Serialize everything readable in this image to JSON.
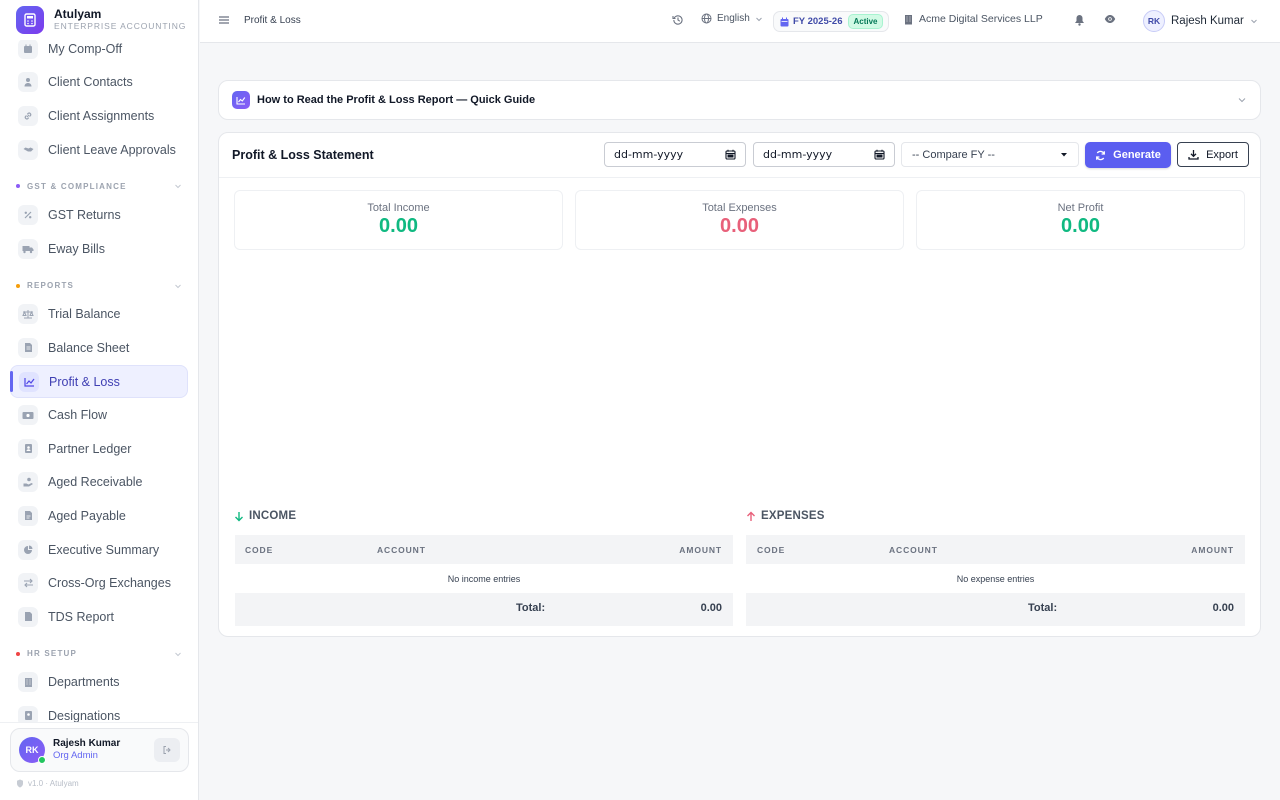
{
  "brand": {
    "name": "Atulyam",
    "tagline": "ENTERPRISE ACCOUNTING"
  },
  "sidebar": {
    "items_top": [
      {
        "label": "My Comp-Off",
        "icon": "calendar-icon"
      },
      {
        "label": "Client Contacts",
        "icon": "person-icon"
      },
      {
        "label": "Client Assignments",
        "icon": "link-icon"
      },
      {
        "label": "Client Leave Approvals",
        "icon": "handshake-icon"
      }
    ],
    "sections": [
      {
        "title": "GST & COMPLIANCE",
        "color": "#8b5cf6",
        "items": [
          {
            "label": "GST Returns",
            "icon": "percent-icon"
          },
          {
            "label": "Eway Bills",
            "icon": "truck-icon"
          }
        ]
      },
      {
        "title": "REPORTS",
        "color": "#f59e0b",
        "items": [
          {
            "label": "Trial Balance",
            "icon": "scale-icon"
          },
          {
            "label": "Balance Sheet",
            "icon": "document-icon"
          },
          {
            "label": "Profit & Loss",
            "icon": "chart-line-icon",
            "active": true
          },
          {
            "label": "Cash Flow",
            "icon": "money-icon"
          },
          {
            "label": "Partner Ledger",
            "icon": "ledger-icon"
          },
          {
            "label": "Aged Receivable",
            "icon": "hand-coin-icon"
          },
          {
            "label": "Aged Payable",
            "icon": "invoice-icon"
          },
          {
            "label": "Executive Summary",
            "icon": "pie-chart-icon"
          },
          {
            "label": "Cross-Org Exchanges",
            "icon": "exchange-icon"
          },
          {
            "label": "TDS Report",
            "icon": "file-icon"
          }
        ]
      },
      {
        "title": "HR SETUP",
        "color": "#ef4444",
        "items": [
          {
            "label": "Departments",
            "icon": "building-icon"
          },
          {
            "label": "Designations",
            "icon": "id-badge-icon"
          }
        ]
      }
    ],
    "user": {
      "initials": "RK",
      "name": "Rajesh Kumar",
      "role": "Org Admin"
    },
    "footer": "v1.0 · Atulyam"
  },
  "topbar": {
    "breadcrumb": "Profit & Loss",
    "language": "English",
    "fy": "FY 2025-26",
    "fy_status": "Active",
    "org": "Acme Digital Services LLP",
    "user_initials": "RK",
    "user_name": "Rajesh Kumar"
  },
  "guide": {
    "title": "How to Read the Profit & Loss Report — Quick Guide"
  },
  "report": {
    "title": "Profit & Loss Statement",
    "from_date": "dd-mm-yyyy",
    "to_date": "dd-mm-yyyy",
    "compare": "-- Compare FY --",
    "generate_label": "Generate",
    "export_label": "Export",
    "kpis": [
      {
        "label": "Total Income",
        "value": "0.00",
        "color": "#10b981"
      },
      {
        "label": "Total Expenses",
        "value": "0.00",
        "color": "#e8607a"
      },
      {
        "label": "Net Profit",
        "value": "0.00",
        "color": "#10b981"
      }
    ],
    "income": {
      "title": "INCOME",
      "columns": [
        "CODE",
        "ACCOUNT",
        "AMOUNT"
      ],
      "empty": "No income entries",
      "total_label": "Total:",
      "total_value": "0.00"
    },
    "expenses": {
      "title": "EXPENSES",
      "columns": [
        "CODE",
        "ACCOUNT",
        "AMOUNT"
      ],
      "empty": "No expense entries",
      "total_label": "Total:",
      "total_value": "0.00"
    }
  },
  "colors": {
    "accent": "#5b5ef0",
    "income": "#10b981",
    "expense": "#e8607a"
  }
}
